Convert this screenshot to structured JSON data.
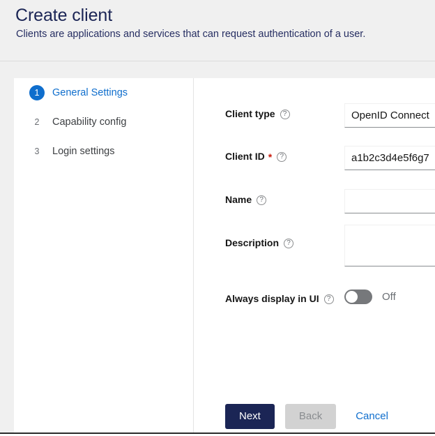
{
  "header": {
    "title": "Create client",
    "subtitle": "Clients are applications and services that can request authentication of a user."
  },
  "wizard": {
    "steps": [
      {
        "number": "1",
        "label": "General Settings",
        "state": "active"
      },
      {
        "number": "2",
        "label": "Capability config",
        "state": "inactive"
      },
      {
        "number": "3",
        "label": "Login settings",
        "state": "inactive"
      }
    ]
  },
  "form": {
    "fields": [
      {
        "id": "client-type",
        "label": "Client type",
        "required": false,
        "help_icon": "help-circle-icon",
        "control": "select",
        "value": "OpenID Connect",
        "placeholder": ""
      },
      {
        "id": "client-id",
        "label": "Client ID",
        "required": true,
        "required_marker": "*",
        "help_icon": "help-circle-icon",
        "control": "text",
        "value": "a1b2c3d4e5f6g7",
        "placeholder": ""
      },
      {
        "id": "name",
        "label": "Name",
        "required": false,
        "help_icon": "help-circle-icon",
        "control": "text",
        "value": "",
        "placeholder": ""
      },
      {
        "id": "description",
        "label": "Description",
        "required": false,
        "help_icon": "help-circle-icon",
        "control": "textarea",
        "value": "",
        "placeholder": ""
      },
      {
        "id": "always-display-in-ui",
        "label": "Always display in UI",
        "required": false,
        "help_icon": "help-circle-icon",
        "control": "toggle",
        "value": "Off",
        "checked": false
      }
    ]
  },
  "footer": {
    "next_label": "Next",
    "back_label": "Back",
    "back_disabled": true,
    "cancel_label": "Cancel"
  },
  "colors": {
    "title": "#1b2555",
    "accent_blue": "#0f6ecd",
    "primary_button": "#1b2555",
    "disabled_button": "#d2d2d2",
    "required_red": "#c9190b",
    "toggle_off": "#76787b",
    "page_background": "#f0f0f0",
    "card_background": "#ffffff"
  }
}
